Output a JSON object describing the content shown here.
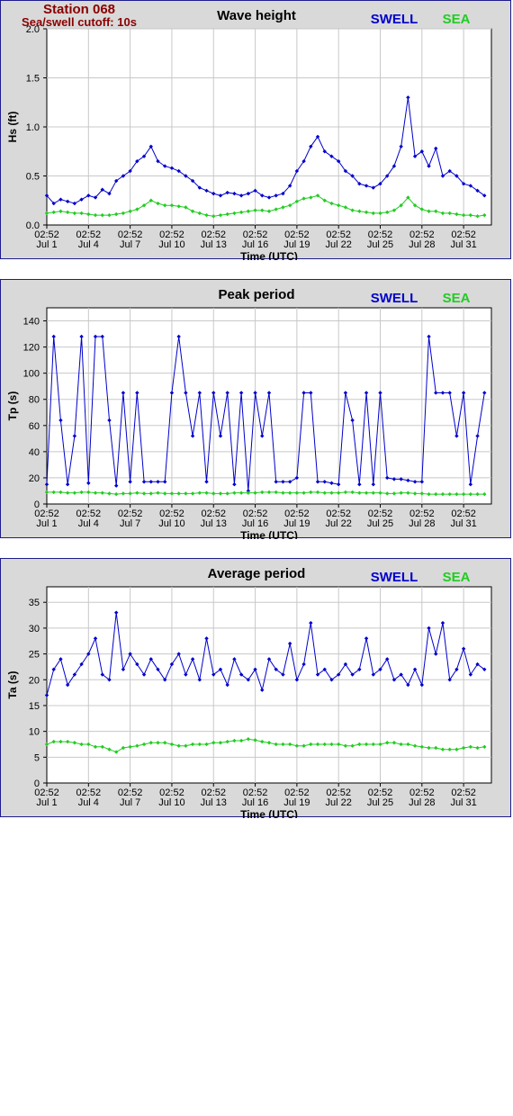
{
  "station": {
    "name": "Station 068",
    "cutoff": "Sea/swell cutoff: 10s"
  },
  "legend": {
    "swell": "SWELL",
    "sea": "SEA"
  },
  "colors": {
    "swell": "#0000cc",
    "sea": "#22cc22",
    "title": "#8b0000",
    "frame": "#1c1c8c"
  },
  "chart_data": [
    {
      "type": "line",
      "title": "Wave height",
      "xlabel": "Time (UTC)",
      "ylabel": "Hs (ft)",
      "ylim": [
        0,
        2.0
      ],
      "yticks": [
        "0.0",
        "0.5",
        "1.0",
        "1.5",
        "2.0"
      ],
      "xtick_time": "02:52",
      "xtick_dates": [
        "Jul 1",
        "Jul 4",
        "Jul 7",
        "Jul 10",
        "Jul 13",
        "Jul 16",
        "Jul 19",
        "Jul 22",
        "Jul 25",
        "Jul 28",
        "Jul 31"
      ],
      "grid": true,
      "legend": "top-right",
      "series": [
        {
          "name": "SWELL",
          "x": [
            0,
            0.5,
            1,
            1.5,
            2,
            2.5,
            3,
            3.5,
            4,
            4.5,
            5,
            5.5,
            6,
            6.5,
            7,
            7.5,
            8,
            8.5,
            9,
            9.5,
            10,
            10.5,
            11,
            11.5,
            12,
            12.5,
            13,
            13.5,
            14,
            14.5,
            15,
            15.5,
            16,
            16.5,
            17,
            17.5,
            18,
            18.5,
            19,
            19.5,
            20,
            20.5,
            21,
            21.5,
            22,
            22.5,
            23,
            23.5,
            24,
            24.5,
            25,
            25.5,
            26,
            26.5,
            27,
            27.5,
            28,
            28.5,
            29,
            29.5,
            30,
            30.5,
            31,
            31.5
          ],
          "values": [
            0.3,
            0.22,
            0.26,
            0.24,
            0.22,
            0.26,
            0.3,
            0.28,
            0.36,
            0.32,
            0.45,
            0.5,
            0.55,
            0.65,
            0.7,
            0.8,
            0.65,
            0.6,
            0.58,
            0.55,
            0.5,
            0.45,
            0.38,
            0.35,
            0.32,
            0.3,
            0.33,
            0.32,
            0.3,
            0.32,
            0.35,
            0.3,
            0.28,
            0.3,
            0.32,
            0.4,
            0.55,
            0.65,
            0.8,
            0.9,
            0.75,
            0.7,
            0.65,
            0.55,
            0.5,
            0.42,
            0.4,
            0.38,
            0.42,
            0.5,
            0.6,
            0.8,
            1.3,
            0.7,
            0.75,
            0.6,
            0.78,
            0.5,
            0.55,
            0.5,
            0.42,
            0.4,
            0.35,
            0.3
          ]
        },
        {
          "name": "SEA",
          "x": [
            0,
            0.5,
            1,
            1.5,
            2,
            2.5,
            3,
            3.5,
            4,
            4.5,
            5,
            5.5,
            6,
            6.5,
            7,
            7.5,
            8,
            8.5,
            9,
            9.5,
            10,
            10.5,
            11,
            11.5,
            12,
            12.5,
            13,
            13.5,
            14,
            14.5,
            15,
            15.5,
            16,
            16.5,
            17,
            17.5,
            18,
            18.5,
            19,
            19.5,
            20,
            20.5,
            21,
            21.5,
            22,
            22.5,
            23,
            23.5,
            24,
            24.5,
            25,
            25.5,
            26,
            26.5,
            27,
            27.5,
            28,
            28.5,
            29,
            29.5,
            30,
            30.5,
            31,
            31.5
          ],
          "values": [
            0.12,
            0.13,
            0.14,
            0.13,
            0.12,
            0.12,
            0.11,
            0.1,
            0.1,
            0.1,
            0.11,
            0.12,
            0.14,
            0.16,
            0.2,
            0.25,
            0.22,
            0.2,
            0.2,
            0.19,
            0.18,
            0.14,
            0.12,
            0.1,
            0.09,
            0.1,
            0.11,
            0.12,
            0.13,
            0.14,
            0.15,
            0.15,
            0.14,
            0.16,
            0.18,
            0.2,
            0.24,
            0.27,
            0.28,
            0.3,
            0.25,
            0.22,
            0.2,
            0.18,
            0.15,
            0.14,
            0.13,
            0.12,
            0.12,
            0.13,
            0.15,
            0.2,
            0.28,
            0.2,
            0.16,
            0.14,
            0.14,
            0.12,
            0.12,
            0.11,
            0.1,
            0.1,
            0.09,
            0.1
          ]
        }
      ]
    },
    {
      "type": "line",
      "title": "Peak period",
      "xlabel": "Time (UTC)",
      "ylabel": "Tp (s)",
      "ylim": [
        0,
        150
      ],
      "yticks": [
        "0",
        "20",
        "40",
        "60",
        "80",
        "100",
        "120",
        "140"
      ],
      "xtick_time": "02:52",
      "xtick_dates": [
        "Jul 1",
        "Jul 4",
        "Jul 7",
        "Jul 10",
        "Jul 13",
        "Jul 16",
        "Jul 19",
        "Jul 22",
        "Jul 25",
        "Jul 28",
        "Jul 31"
      ],
      "grid": true,
      "legend": "top-right",
      "series": [
        {
          "name": "SWELL",
          "x": [
            0,
            0.5,
            1,
            1.5,
            2,
            2.5,
            3,
            3.5,
            4,
            4.5,
            5,
            5.5,
            6,
            6.5,
            7,
            7.5,
            8,
            8.5,
            9,
            9.5,
            10,
            10.5,
            11,
            11.5,
            12,
            12.5,
            13,
            13.5,
            14,
            14.5,
            15,
            15.5,
            16,
            16.5,
            17,
            17.5,
            18,
            18.5,
            19,
            19.5,
            20,
            20.5,
            21,
            21.5,
            22,
            22.5,
            23,
            23.5,
            24,
            24.5,
            25,
            25.5,
            26,
            26.5,
            27,
            27.5,
            28,
            28.5,
            29,
            29.5,
            30,
            30.5,
            31,
            31.5
          ],
          "values": [
            15,
            128,
            64,
            15,
            52,
            128,
            16,
            128,
            128,
            64,
            14,
            85,
            17,
            85,
            17,
            17,
            17,
            17,
            85,
            128,
            85,
            52,
            85,
            17,
            85,
            52,
            85,
            15,
            85,
            10,
            85,
            52,
            85,
            17,
            17,
            17,
            20,
            85,
            85,
            17,
            17,
            16,
            15,
            85,
            64,
            15,
            85,
            15,
            85,
            20,
            19,
            19,
            18,
            17,
            17,
            128,
            85,
            85,
            85,
            52,
            85,
            15,
            52,
            85
          ]
        },
        {
          "name": "SEA",
          "x": [
            0,
            0.5,
            1,
            1.5,
            2,
            2.5,
            3,
            3.5,
            4,
            4.5,
            5,
            5.5,
            6,
            6.5,
            7,
            7.5,
            8,
            8.5,
            9,
            9.5,
            10,
            10.5,
            11,
            11.5,
            12,
            12.5,
            13,
            13.5,
            14,
            14.5,
            15,
            15.5,
            16,
            16.5,
            17,
            17.5,
            18,
            18.5,
            19,
            19.5,
            20,
            20.5,
            21,
            21.5,
            22,
            22.5,
            23,
            23.5,
            24,
            24.5,
            25,
            25.5,
            26,
            26.5,
            27,
            27.5,
            28,
            28.5,
            29,
            29.5,
            30,
            30.5,
            31,
            31.5
          ],
          "values": [
            9,
            9,
            9,
            8.5,
            8.5,
            9,
            9,
            8.5,
            8.5,
            8,
            7.5,
            8,
            8,
            8.5,
            8,
            8,
            8.5,
            8,
            8,
            8,
            8,
            8,
            8.5,
            8.5,
            8,
            8,
            8,
            8.5,
            8.5,
            8.5,
            8.5,
            9,
            9,
            9,
            8.5,
            8.5,
            8.5,
            8.5,
            9,
            9,
            8.5,
            8.5,
            8.5,
            9,
            9,
            8.5,
            8.5,
            8.5,
            8.5,
            8,
            8,
            8.5,
            8.5,
            8,
            8,
            7.5,
            7.5,
            7.5,
            7.5,
            7.5,
            7.5,
            7.5,
            7.5,
            7.5
          ]
        }
      ]
    },
    {
      "type": "line",
      "title": "Average period",
      "xlabel": "Time (UTC)",
      "ylabel": "Ta (s)",
      "ylim": [
        0,
        38
      ],
      "yticks": [
        "0",
        "5",
        "10",
        "15",
        "20",
        "25",
        "30",
        "35"
      ],
      "xtick_time": "02:52",
      "xtick_dates": [
        "Jul 1",
        "Jul 4",
        "Jul 7",
        "Jul 10",
        "Jul 13",
        "Jul 16",
        "Jul 19",
        "Jul 22",
        "Jul 25",
        "Jul 28",
        "Jul 31"
      ],
      "grid": true,
      "legend": "top-right",
      "series": [
        {
          "name": "SWELL",
          "x": [
            0,
            0.5,
            1,
            1.5,
            2,
            2.5,
            3,
            3.5,
            4,
            4.5,
            5,
            5.5,
            6,
            6.5,
            7,
            7.5,
            8,
            8.5,
            9,
            9.5,
            10,
            10.5,
            11,
            11.5,
            12,
            12.5,
            13,
            13.5,
            14,
            14.5,
            15,
            15.5,
            16,
            16.5,
            17,
            17.5,
            18,
            18.5,
            19,
            19.5,
            20,
            20.5,
            21,
            21.5,
            22,
            22.5,
            23,
            23.5,
            24,
            24.5,
            25,
            25.5,
            26,
            26.5,
            27,
            27.5,
            28,
            28.5,
            29,
            29.5,
            30,
            30.5,
            31,
            31.5
          ],
          "values": [
            17,
            22,
            24,
            19,
            21,
            23,
            25,
            28,
            21,
            20,
            33,
            22,
            25,
            23,
            21,
            24,
            22,
            20,
            23,
            25,
            21,
            24,
            20,
            28,
            21,
            22,
            19,
            24,
            21,
            20,
            22,
            18,
            24,
            22,
            21,
            27,
            20,
            23,
            31,
            21,
            22,
            20,
            21,
            23,
            21,
            22,
            28,
            21,
            22,
            24,
            20,
            21,
            19,
            22,
            19,
            30,
            25,
            31,
            20,
            22,
            26,
            21,
            23,
            22
          ]
        },
        {
          "name": "SEA",
          "x": [
            0,
            0.5,
            1,
            1.5,
            2,
            2.5,
            3,
            3.5,
            4,
            4.5,
            5,
            5.5,
            6,
            6.5,
            7,
            7.5,
            8,
            8.5,
            9,
            9.5,
            10,
            10.5,
            11,
            11.5,
            12,
            12.5,
            13,
            13.5,
            14,
            14.5,
            15,
            15.5,
            16,
            16.5,
            17,
            17.5,
            18,
            18.5,
            19,
            19.5,
            20,
            20.5,
            21,
            21.5,
            22,
            22.5,
            23,
            23.5,
            24,
            24.5,
            25,
            25.5,
            26,
            26.5,
            27,
            27.5,
            28,
            28.5,
            29,
            29.5,
            30,
            30.5,
            31,
            31.5
          ],
          "values": [
            7.5,
            8,
            8,
            8,
            7.8,
            7.5,
            7.5,
            7,
            7,
            6.5,
            6,
            6.8,
            7,
            7.2,
            7.5,
            7.8,
            7.8,
            7.8,
            7.5,
            7.2,
            7.2,
            7.5,
            7.5,
            7.5,
            7.8,
            7.8,
            8,
            8.2,
            8.2,
            8.5,
            8.3,
            8,
            7.8,
            7.5,
            7.5,
            7.5,
            7.2,
            7.2,
            7.5,
            7.5,
            7.5,
            7.5,
            7.5,
            7.2,
            7.2,
            7.5,
            7.5,
            7.5,
            7.5,
            7.8,
            7.8,
            7.5,
            7.5,
            7.2,
            7,
            6.8,
            6.8,
            6.5,
            6.5,
            6.5,
            6.8,
            7,
            6.8,
            7
          ]
        }
      ]
    }
  ]
}
